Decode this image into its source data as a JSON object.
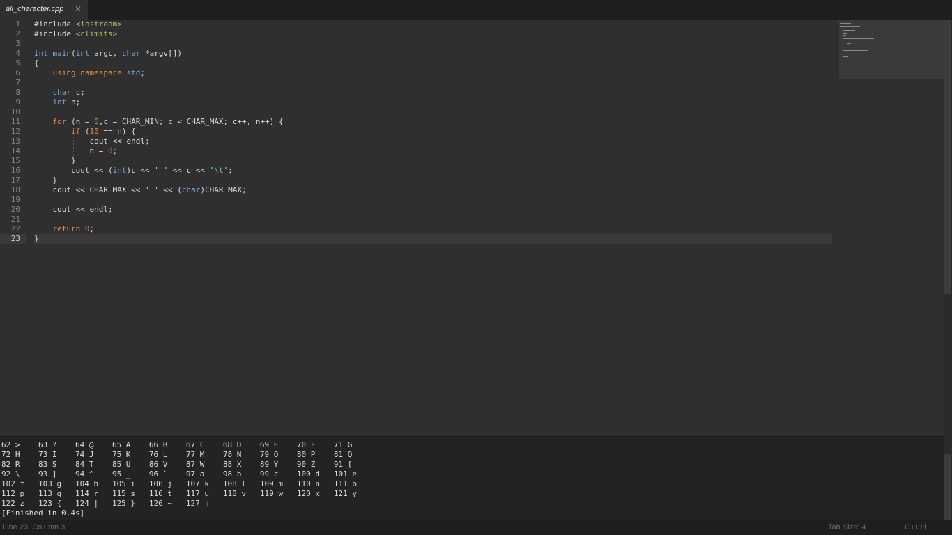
{
  "tab": {
    "title": "all_character.cpp",
    "close_glyph": "✕"
  },
  "editor": {
    "current_line": 23,
    "line_numbers": [
      "1",
      "2",
      "3",
      "4",
      "5",
      "6",
      "7",
      "8",
      "9",
      "10",
      "11",
      "12",
      "13",
      "14",
      "15",
      "16",
      "17",
      "18",
      "19",
      "20",
      "21",
      "22",
      "23"
    ],
    "code_lines": [
      "#include <iostream>",
      "#include <climits>",
      "",
      "int main(int argc, char *argv[])",
      "{",
      "    using namespace std;",
      "",
      "    char c;",
      "    int n;",
      "",
      "    for (n = 0,c = CHAR_MIN; c < CHAR_MAX; c++, n++) {",
      "        if (10 == n) {",
      "            cout << endl;",
      "            n = 0;",
      "        }",
      "        cout << (int)c << ' ' << c << '\\t';",
      "    }",
      "    cout << CHAR_MAX << ' ' << (char)CHAR_MAX;",
      "",
      "    cout << endl;",
      "",
      "    return 0;",
      "}"
    ]
  },
  "output": {
    "lines": [
      "62 >    63 ?    64 @    65 A    66 B    67 C    68 D    69 E    70 F    71 G",
      "72 H    73 I    74 J    75 K    76 L    77 M    78 N    79 O    80 P    81 Q",
      "82 R    83 S    84 T    85 U    86 V    87 W    88 X    89 Y    90 Z    91 [",
      "92 \\    93 ]    94 ^    95 _    96 `    97 a    98 b    99 c    100 d   101 e",
      "102 f   103 g   104 h   105 i   106 j   107 k   108 l   109 m   110 n   111 o",
      "112 p   113 q   114 r   115 s   116 t   117 u   118 v   119 w   120 x   121 y",
      "122 z   123 {   124 |   125 }   126 ~   127 ▯",
      "[Finished in 0.4s]"
    ]
  },
  "statusbar": {
    "position": "Line 23, Column 3",
    "tab_size": "Tab Size: 4",
    "syntax": "C++11"
  },
  "colors": {
    "keyword": "#e38c43",
    "type": "#7aa6da",
    "include_path": "#a5c261",
    "number": "#e38c43",
    "escape": "#6dc7c7",
    "background": "#2f2f2f"
  }
}
